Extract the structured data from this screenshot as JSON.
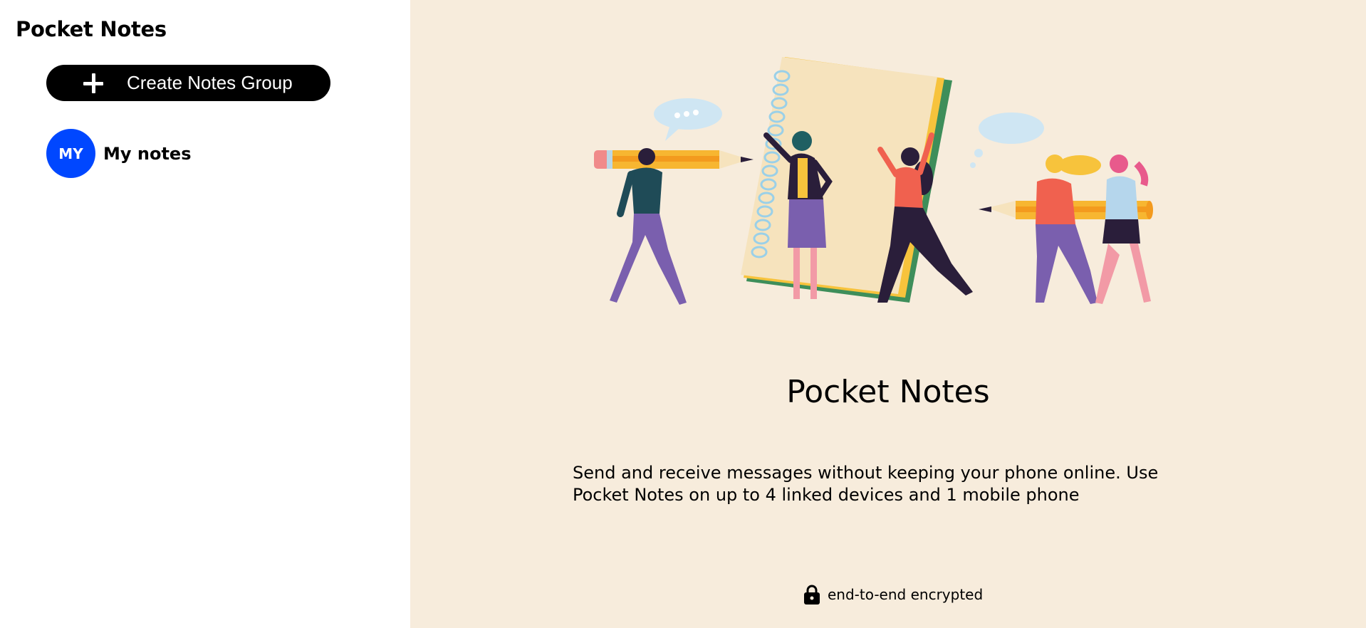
{
  "sidebar": {
    "app_title": "Pocket Notes",
    "create_button_label": "Create Notes Group",
    "groups": [
      {
        "initials": "MY",
        "name": "My notes",
        "color": "#0047ff"
      }
    ]
  },
  "main": {
    "title": "Pocket Notes",
    "description": "Send and receive messages without keeping your phone online. Use Pocket Notes on up to 4 linked devices and 1 mobile phone",
    "encryption_note": "end-to-end encrypted",
    "background_color": "#f7ecdc"
  },
  "icons": [
    "plus-icon",
    "lock-icon"
  ]
}
